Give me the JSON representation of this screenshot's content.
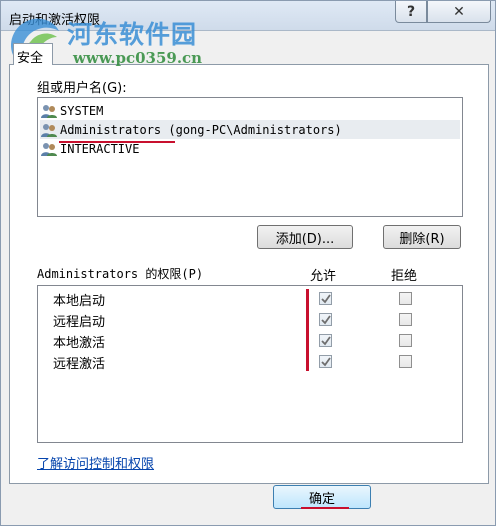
{
  "window": {
    "title": "启动和激活权限",
    "help_glyph": "?",
    "close_glyph": "✕"
  },
  "watermark": {
    "title": "河东软件园",
    "url": "www.pc0359.cn"
  },
  "tabs": [
    {
      "label": "安全"
    }
  ],
  "groups": {
    "label": "组或用户名(G):",
    "items": [
      {
        "name": "SYSTEM",
        "selected": false,
        "icon": "user-group-icon"
      },
      {
        "name": "Administrators (gong-PC\\Administrators)",
        "selected": true,
        "icon": "user-group-icon"
      },
      {
        "name": "INTERACTIVE",
        "selected": false,
        "icon": "user-group-icon"
      }
    ]
  },
  "buttons": {
    "add": "添加(D)...",
    "remove": "删除(R)",
    "ok": "确定"
  },
  "permissions": {
    "label": "Administrators 的权限(P)",
    "allow_header": "允许",
    "deny_header": "拒绝",
    "rows": [
      {
        "name": "本地启动",
        "allow": true,
        "deny": false
      },
      {
        "name": "远程启动",
        "allow": true,
        "deny": false
      },
      {
        "name": "本地激活",
        "allow": true,
        "deny": false
      },
      {
        "name": "远程激活",
        "allow": true,
        "deny": false
      }
    ]
  },
  "link": "了解访问控制和权限",
  "colors": {
    "accent_red": "#c8102e",
    "link_blue": "#0645ad",
    "watermark_blue": "#3a8fd6",
    "watermark_green": "#2e8b3a"
  }
}
